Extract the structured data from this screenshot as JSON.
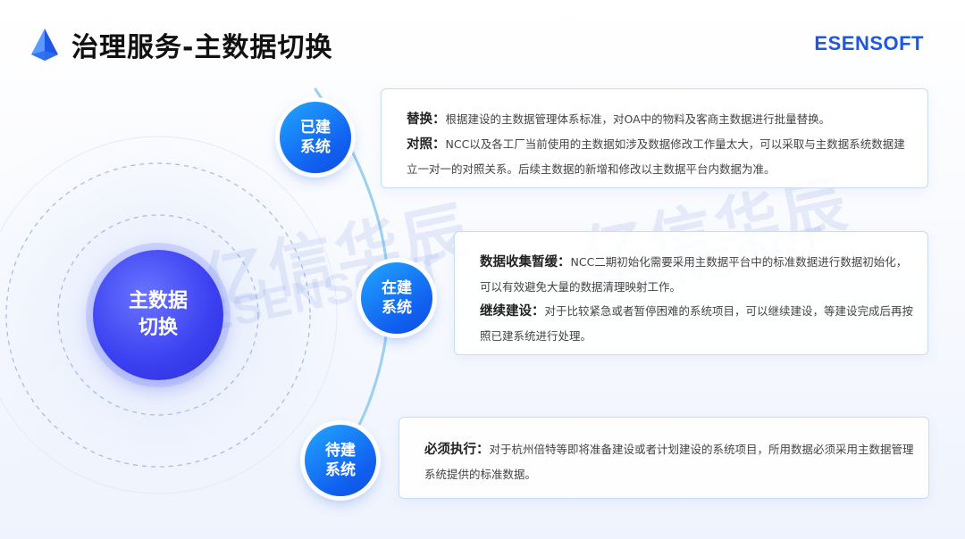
{
  "header": {
    "title": "治理服务-主数据切换",
    "brand": "ESENSOFT"
  },
  "watermark": {
    "cn": "亿信华辰",
    "en": "ESENSOFT"
  },
  "center": {
    "label": "主数据\n切换"
  },
  "sections": [
    {
      "label": "已建\n系统",
      "items": [
        {
          "term": "替换：",
          "text": "根据建设的主数据管理体系标准，对OA中的物料及客商主数据进行批量替换。"
        },
        {
          "term": "对照：",
          "text": "NCC以及各工厂当前使用的主数据如涉及数据修改工作量太大，可以采取与主数据系统数据建立一对一的对照关系。后续主数据的新增和修改以主数据平台内数据为准。"
        }
      ]
    },
    {
      "label": "在建\n系统",
      "items": [
        {
          "term": "数据收集暂缓：",
          "text": "NCC二期初始化需要采用主数据平台中的标准数据进行数据初始化，可以有效避免大量的数据清理映射工作。"
        },
        {
          "term": "继续建设：",
          "text": "对于比较紧急或者暂停困难的系统项目，可以继续建设，等建设完成后再按照已建系统进行处理。"
        }
      ]
    },
    {
      "label": "待建\n系统",
      "items": [
        {
          "term": "必须执行：",
          "text": "对于杭州倍特等即将准备建设或者计划建设的系统项目，所用数据必须采用主数据管理系统提供的标准数据。"
        }
      ]
    }
  ],
  "colors": {
    "brand": "#1e56e6",
    "center": "#3a3ff0",
    "node": "#1160f0",
    "card_border": "#c8dbf7"
  }
}
